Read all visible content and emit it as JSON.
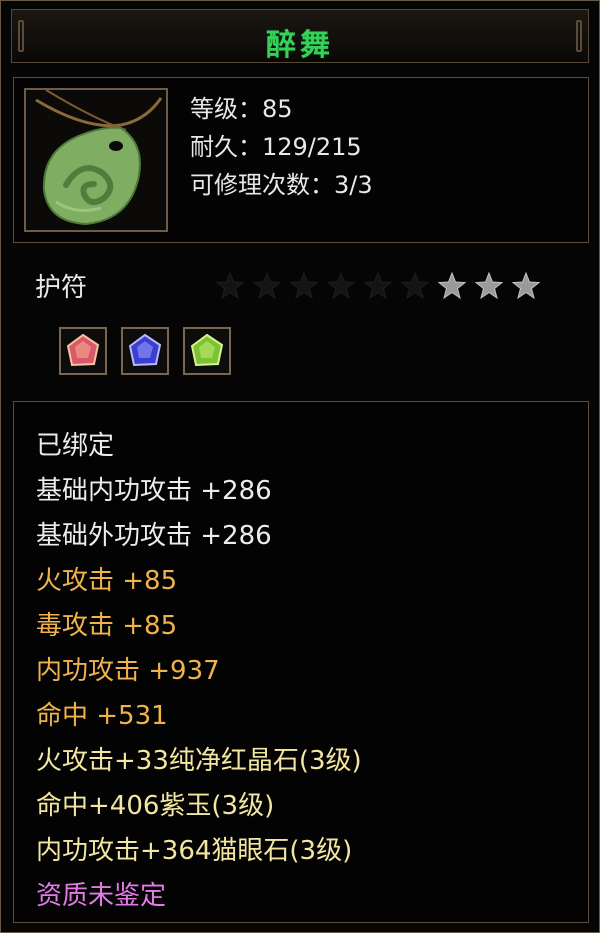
{
  "title": "醉舞",
  "item": {
    "icon": "jade-pendant-icon",
    "stats": [
      "等级：85",
      "耐久：129/215",
      "可修理次数：3/3"
    ],
    "type": "护符",
    "stars": {
      "total": 9,
      "lit": 3
    },
    "gems": [
      {
        "icon": "red-crystal-gem-icon",
        "color": "#e0606a"
      },
      {
        "icon": "purple-jade-gem-icon",
        "color": "#5a5ae8"
      },
      {
        "icon": "cats-eye-gem-icon",
        "color": "#8cd23a"
      }
    ]
  },
  "attributes": [
    {
      "text": "已绑定",
      "color": "#ececec"
    },
    {
      "text": "基础内功攻击  +286",
      "color": "#ececec"
    },
    {
      "text": "基础外功攻击  +286",
      "color": "#ececec"
    },
    {
      "text": "火攻击  +85",
      "color": "#f0b24a"
    },
    {
      "text": "毒攻击  +85",
      "color": "#f0b24a"
    },
    {
      "text": "内功攻击  +937",
      "color": "#f0b24a"
    },
    {
      "text": "命中  +531",
      "color": "#f0b24a"
    },
    {
      "text": "火攻击+33纯净红晶石(3级)",
      "color": "#f3e6a0"
    },
    {
      "text": "命中+406紫玉(3级)",
      "color": "#f3e6a0"
    },
    {
      "text": "内功攻击+364猫眼石(3级)",
      "color": "#f3e6a0"
    },
    {
      "text": "资质未鉴定",
      "color": "#e27be6"
    }
  ]
}
